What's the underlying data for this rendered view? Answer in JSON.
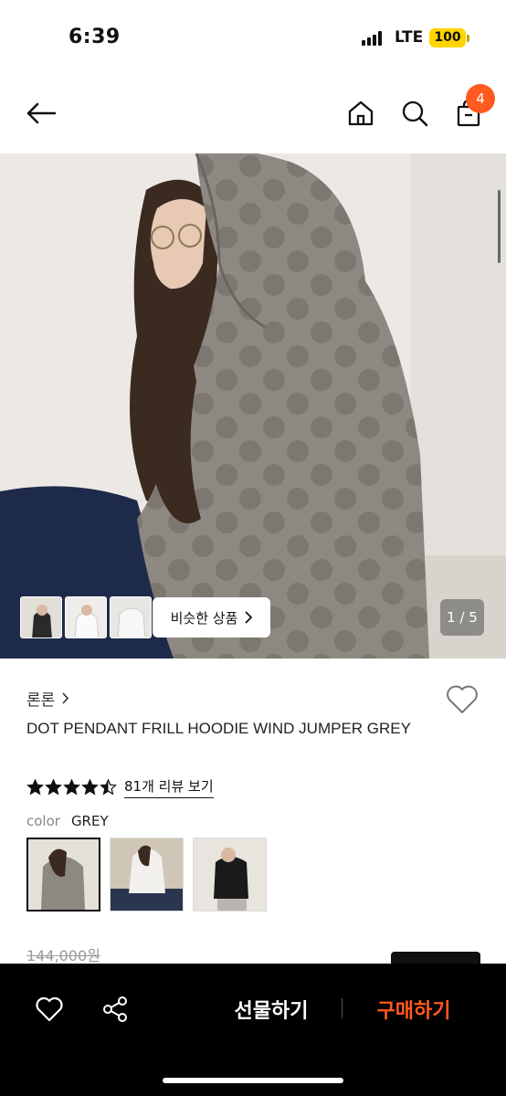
{
  "status": {
    "time": "6:39",
    "network": "LTE",
    "battery": "100"
  },
  "header": {
    "cart_count": "4"
  },
  "hero": {
    "similar_label": "비슷한 상품",
    "page_indicator": "1 / 5"
  },
  "product": {
    "brand": "론론",
    "name": "DOT PENDANT FRILL HOODIE WIND JUMPER GREY",
    "rating": 4.5,
    "review_link": "81개 리뷰 보기",
    "color_label": "color",
    "color_value": "GREY",
    "original_price": "144,000원"
  },
  "bottom_bar": {
    "gift_label": "선물하기",
    "buy_label": "구매하기"
  },
  "colors": {
    "accent": "#ff5a1f",
    "battery": "#ffd400",
    "bar_bg": "#000000"
  },
  "icons": [
    "back-arrow-icon",
    "home-icon",
    "search-icon",
    "shopping-bag-icon",
    "heart-icon",
    "share-icon",
    "star-icon",
    "chevron-right-icon"
  ]
}
